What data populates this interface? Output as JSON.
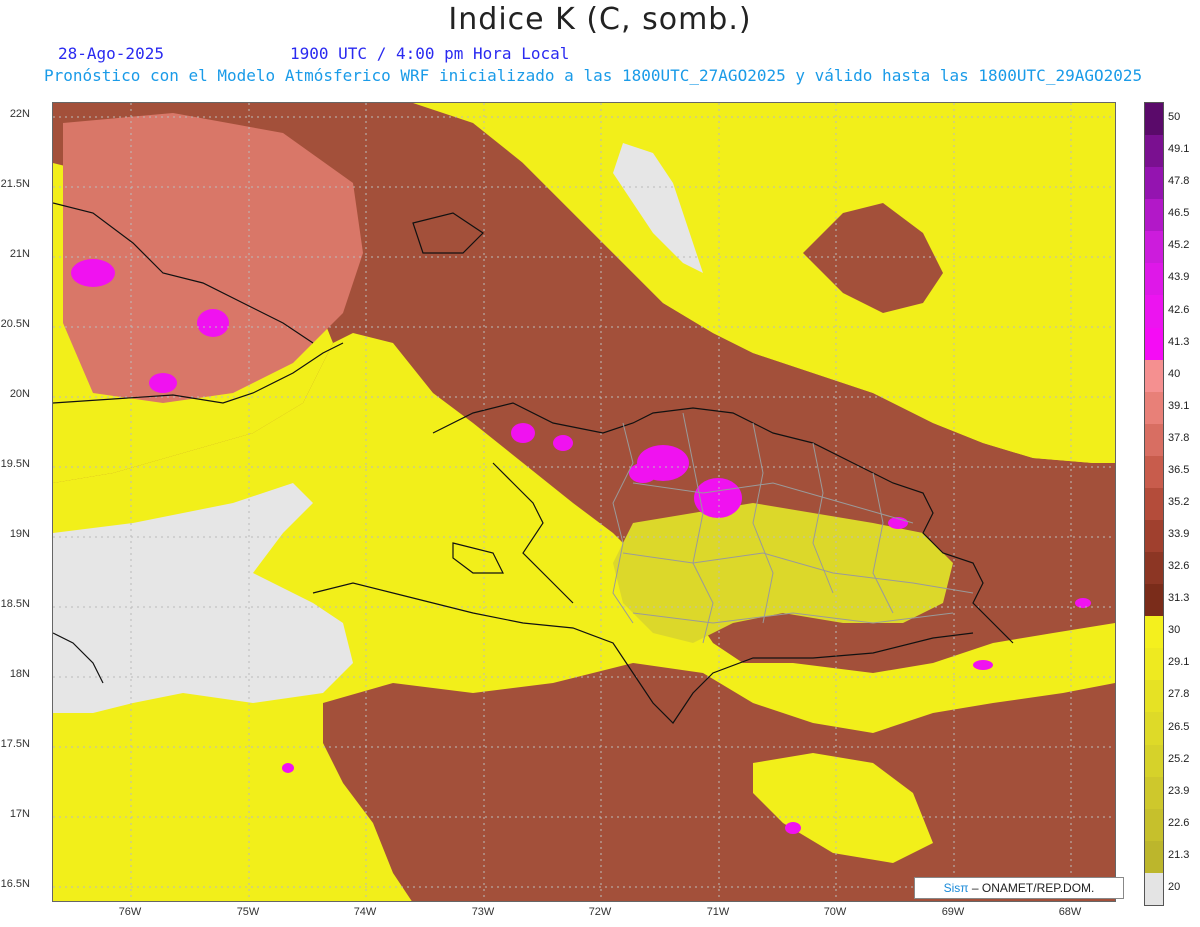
{
  "header": {
    "title": "Indice K (C, somb.)",
    "date": "28-Ago-2025",
    "time": "1900 UTC / 4:00 pm Hora Local",
    "forecast_line": "Pronóstico con el Modelo Atmósferico WRF inicializado a las 1800UTC_27AGO2025 y válido hasta las  1800UTC_29AGO2025"
  },
  "map": {
    "lat_labels": [
      "22N",
      "21.5N",
      "21N",
      "20.5N",
      "20N",
      "19.5N",
      "19N",
      "18.5N",
      "18N",
      "17.5N",
      "17N",
      "16.5N"
    ],
    "lon_labels": [
      "76W",
      "75W",
      "74W",
      "73W",
      "72W",
      "71W",
      "70W",
      "69W",
      "68W"
    ],
    "colors": {
      "sea_low": "#f2ef1a",
      "land_nodata": "#e6e6e6",
      "brown_dark": "#8b3a20",
      "brown_mid": "#a3503a",
      "salmon": "#d97768",
      "magenta": "#f012f0",
      "coast": "#111111",
      "provinces": "#9a9a9a"
    }
  },
  "credit": {
    "brand": "Sisπ",
    "text": " – ONAMET/REP.DOM."
  },
  "colorbar": {
    "labels": [
      "50",
      "49.1",
      "47.8",
      "46.5",
      "45.2",
      "43.9",
      "42.6",
      "41.3",
      "40",
      "39.1",
      "37.8",
      "36.5",
      "35.2",
      "33.9",
      "32.6",
      "31.3",
      "30",
      "29.1",
      "27.8",
      "26.5",
      "25.2",
      "23.9",
      "22.6",
      "21.3",
      "20"
    ],
    "colors": [
      "#5a0a6a",
      "#7a1090",
      "#9414b0",
      "#b218c8",
      "#cc1cdc",
      "#de18e8",
      "#ec14f0",
      "#f50cf5",
      "#f59090",
      "#e88078",
      "#d86e62",
      "#c85c4c",
      "#b44c3a",
      "#a0402e",
      "#8c3624",
      "#7a2c1a",
      "#f4f01e",
      "#eeea20",
      "#e6e224",
      "#deda28",
      "#d6d22a",
      "#cec82c",
      "#c6c02c",
      "#bcb62c",
      "#e4e4e4"
    ]
  }
}
